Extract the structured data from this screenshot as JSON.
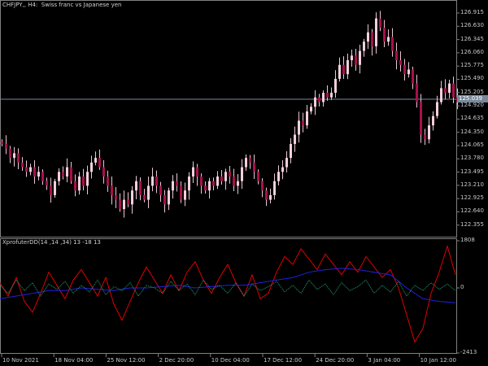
{
  "header": {
    "symbol_title": "CHFJPY,, H4:  Swiss franc vs Japanese yen"
  },
  "indicator": {
    "title": "XprofuterDD(14 ,14 ,34) 13 -18 13"
  },
  "current_price": "125.039",
  "colors": {
    "background": "#000000",
    "bull": "#f4d0dc",
    "bear": "#a8104c",
    "wick": "#e8c8d4",
    "grid": "#808080",
    "red_line": "#e00000",
    "blue_line": "#2020e0",
    "green_line": "#20a070",
    "price_line": "#778899"
  },
  "chart_data": [
    {
      "type": "candlestick",
      "title": "CHFJPY,, H4:  Swiss franc vs Japanese yen",
      "yticks": [
        "126.915",
        "126.630",
        "126.345",
        "126.060",
        "125.775",
        "125.490",
        "125.205",
        "124.920",
        "124.635",
        "124.350",
        "124.065",
        "123.780",
        "123.495",
        "123.210",
        "122.925",
        "122.640",
        "122.355"
      ],
      "xticks": [
        "10 Nov 2021",
        "18 Nov 04:00",
        "25 Nov 12:00",
        "2 Dec 20:00",
        "10 Dec 04:00",
        "17 Dec 12:00",
        "24 Dec 20:00",
        "3 Jan 04:00",
        "10 Jan 12:00"
      ],
      "ylim": [
        122.1,
        127.2
      ],
      "close": [
        124.1,
        124.0,
        123.8,
        123.9,
        123.7,
        123.6,
        123.5,
        123.6,
        123.4,
        123.5,
        123.3,
        123.2,
        123.0,
        123.3,
        123.5,
        123.4,
        123.6,
        123.3,
        123.1,
        123.4,
        123.2,
        123.5,
        123.7,
        123.8,
        123.6,
        123.4,
        123.2,
        123.0,
        122.9,
        122.7,
        122.9,
        122.8,
        123.1,
        123.3,
        123.0,
        122.9,
        123.2,
        123.4,
        123.2,
        123.0,
        122.8,
        123.1,
        123.3,
        123.2,
        122.9,
        123.1,
        123.4,
        123.6,
        123.4,
        123.2,
        123.1,
        123.3,
        123.2,
        123.4,
        123.3,
        123.5,
        123.4,
        123.2,
        123.3,
        123.6,
        123.8,
        123.7,
        123.5,
        123.3,
        123.1,
        122.9,
        123.0,
        123.3,
        123.5,
        123.6,
        123.8,
        124.1,
        124.3,
        124.6,
        124.5,
        124.8,
        124.9,
        125.1,
        125.0,
        125.2,
        125.1,
        125.2,
        125.5,
        125.8,
        125.6,
        125.9,
        126.0,
        125.8,
        126.1,
        126.3,
        126.5,
        126.2,
        126.8,
        126.6,
        126.3,
        126.4,
        126.1,
        125.9,
        125.8,
        125.6,
        125.7,
        125.4,
        125.0,
        124.3,
        124.2,
        124.5,
        124.7,
        125.0,
        125.3,
        125.2,
        125.4,
        125.1,
        125.0
      ]
    },
    {
      "type": "line",
      "title": "XprofuterDD(14 ,14 ,34) 13 -18 13",
      "yticks": [
        "1808",
        "0",
        "-2413"
      ],
      "ylim": [
        -2413,
        1808
      ],
      "series": [
        {
          "color": "#e00000",
          "values": [
            200,
            -300,
            400,
            -500,
            -900,
            -200,
            600,
            100,
            -400,
            300,
            700,
            200,
            -300,
            400,
            -600,
            -1200,
            -500,
            200,
            800,
            300,
            -200,
            500,
            -100,
            600,
            1000,
            300,
            -200,
            400,
            900,
            200,
            -300,
            500,
            -400,
            -200,
            600,
            1200,
            900,
            1500,
            1100,
            700,
            1300,
            900,
            500,
            1000,
            600,
            1200,
            800,
            400,
            700,
            0,
            -1000,
            -2000,
            -1500,
            -200,
            600,
            1600,
            500
          ]
        },
        {
          "color": "#2020e0",
          "values": [
            -400,
            -300,
            -200,
            -100,
            -100,
            0,
            -50,
            -100,
            0,
            0,
            50,
            100,
            0,
            50,
            100,
            100,
            200,
            300,
            400,
            600,
            700,
            750,
            700,
            600,
            500,
            0,
            -400,
            -500,
            -550
          ]
        },
        {
          "color": "#20a070",
          "values": [
            100,
            -200,
            300,
            -100,
            200,
            -300,
            150,
            -50,
            250,
            -200,
            100,
            -150,
            300,
            -250,
            50,
            -100,
            200,
            -300,
            100,
            0,
            -200,
            250,
            -100,
            150,
            -250,
            300,
            -50,
            100,
            -200,
            200,
            -300,
            150,
            -100,
            50,
            250,
            -150,
            100,
            -200,
            300,
            -50,
            150,
            -250,
            200,
            -100,
            50,
            300,
            -200,
            100,
            -150,
            250,
            -300,
            100,
            -100,
            200,
            -50,
            150,
            -100
          ]
        }
      ]
    }
  ]
}
